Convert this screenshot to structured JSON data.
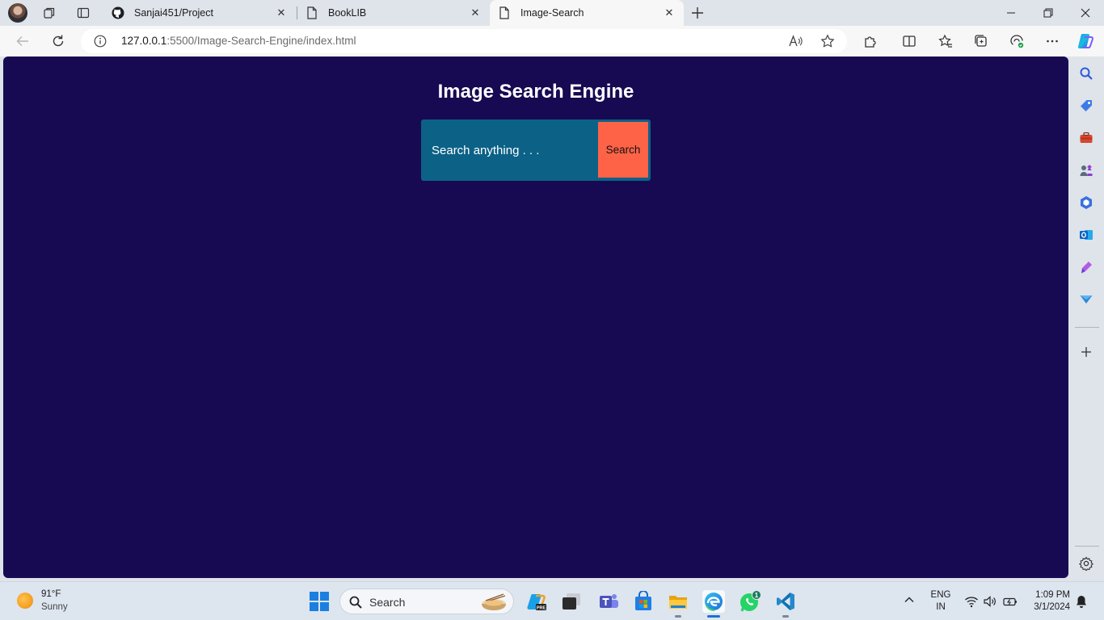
{
  "browser": {
    "tabs": [
      {
        "title": "Sanjai451/Project",
        "favicon": "github-icon",
        "active": false
      },
      {
        "title": "BookLIB",
        "favicon": "page-icon",
        "active": false
      },
      {
        "title": "Image-Search",
        "favicon": "page-icon",
        "active": true
      }
    ],
    "address": {
      "host": "127.0.0.1",
      "rest": ":5500/Image-Search-Engine/index.html"
    }
  },
  "page": {
    "heading": "Image Search Engine",
    "search_placeholder": "Search anything . . .",
    "search_button": "Search",
    "colors": {
      "background": "#170a52",
      "form": "#0c6186",
      "button": "#ff6347"
    }
  },
  "taskbar": {
    "weather_temp": "91°F",
    "weather_condition": "Sunny",
    "search_label": "Search",
    "language_line1": "ENG",
    "language_line2": "IN",
    "time": "1:09 PM",
    "date": "3/1/2024",
    "whatsapp_badge": "1"
  }
}
